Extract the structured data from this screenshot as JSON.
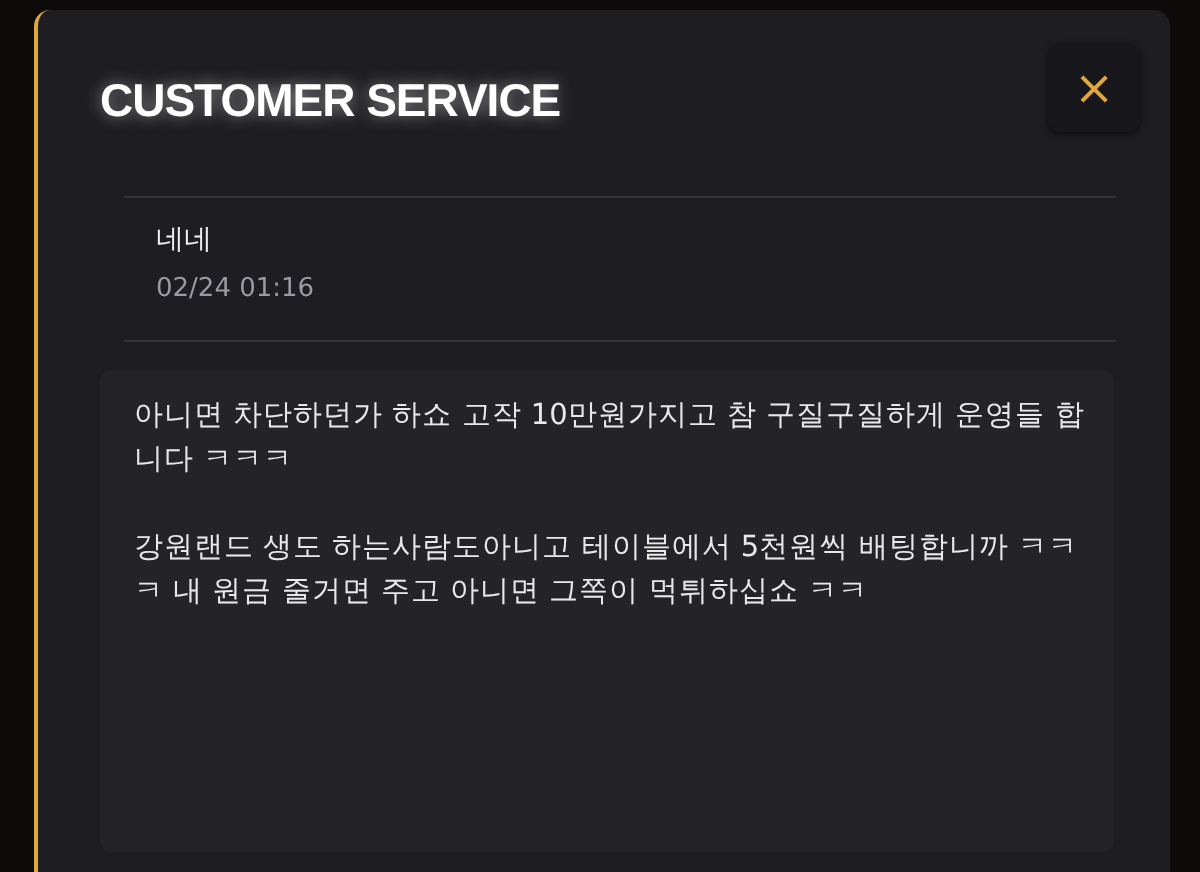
{
  "dialog": {
    "title": "CUSTOMER SERVICE",
    "close": "×"
  },
  "post": {
    "title": "네네",
    "date": "02/24 01:16"
  },
  "message": {
    "paragraphs": [
      "아니면 차단하던가 하쇼 고작 10만원가지고 참 구질구질하게 운영들 합니다 ㅋㅋㅋ",
      "강원랜드 생도 하는사람도아니고 테이블에서 5천원씩 배팅합니까 ㅋㅋㅋ 내 원금 줄거면 주고 아니면 그쪽이 먹튀하십쇼 ㅋㅋ"
    ]
  }
}
